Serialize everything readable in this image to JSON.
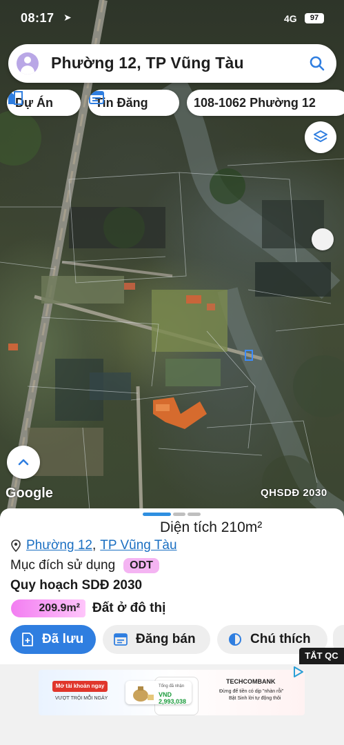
{
  "status_bar": {
    "time": "08:17",
    "network": "4G",
    "battery": "97"
  },
  "search": {
    "title": "Phường 12, TP Vũng Tàu"
  },
  "chips": [
    {
      "label": "Dự Án"
    },
    {
      "label": "Tin Đăng"
    },
    {
      "label": "108-1062 Phường 12"
    }
  ],
  "map": {
    "attribution": "Google",
    "overlay_label": "QHSDĐ 2030"
  },
  "sheet": {
    "area": "Diện tích 210m²",
    "location": {
      "ward": "Phường 12",
      "separator": ",",
      "city": "TP Vũng Tàu"
    },
    "purpose_label": "Mục đích sử dụng",
    "purpose_code": "ODT",
    "plan_title": "Quy hoạch SDĐ 2030",
    "plan_area": "209.9m²",
    "plan_desc": "Đất ở đô thị",
    "buttons": {
      "saved": "Đã lưu",
      "post": "Đăng bán",
      "legend": "Chú thích"
    }
  },
  "ad": {
    "close_label": "TẮT QC",
    "cta": "Mở tài khoản ngay",
    "sub": "VƯỢT TRỘI MỖI NGÀY",
    "card_label": "Tổng đã nhận",
    "card_value": "VND 2,993,038",
    "bank": "TECHCOMBANK",
    "line1": "Đừng để tiền có dịp \"nhàn rỗi\"",
    "line2": "Bật Sinh lời tự động thôi"
  },
  "colors": {
    "primary": "#2f7ee0",
    "odt_pink": "#f4b4f2",
    "link": "#1a6fc2"
  }
}
